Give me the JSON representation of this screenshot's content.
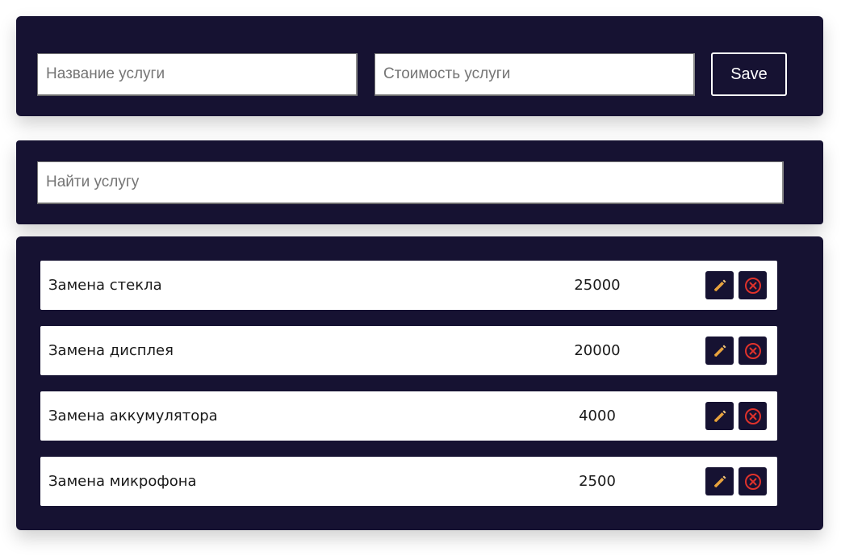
{
  "form": {
    "name_placeholder": "Название услуги",
    "price_placeholder": "Стоимость услуги",
    "save_label": "Save"
  },
  "search": {
    "placeholder": "Найти услугу"
  },
  "services": [
    {
      "name": "Замена стекла",
      "price": "25000"
    },
    {
      "name": "Замена дисплея",
      "price": "20000"
    },
    {
      "name": "Замена аккумулятора",
      "price": "4000"
    },
    {
      "name": "Замена микрофона",
      "price": "2500"
    }
  ],
  "icons": {
    "edit": "pencil-icon",
    "delete": "close-circle-icon"
  },
  "colors": {
    "panel_bg": "#161232",
    "pencil": "#e8a33d",
    "delete": "#e0322b"
  }
}
